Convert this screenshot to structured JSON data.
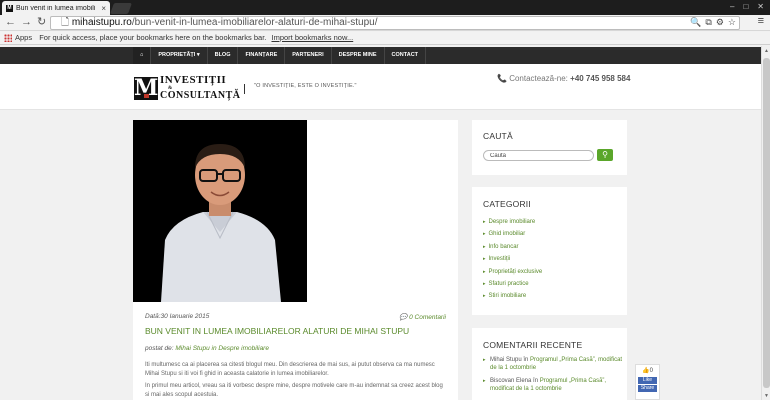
{
  "browser": {
    "tab_title": "Bun venit in lumea imobili",
    "url_host": "mihaistupu.ro",
    "url_path": "/bun-venit-in-lumea-imobiliarelor-alaturi-de-mihai-stupu/",
    "bookmarks_apps": "Apps",
    "bookmarks_text": "For quick access, place your bookmarks here on the bookmarks bar.",
    "bookmarks_import": "Import bookmarks now..."
  },
  "nav": {
    "items": [
      "PROPRIETĂȚI ▾",
      "BLOG",
      "FINANȚARE",
      "PARTENERI",
      "DESPRE MINE",
      "CONTACT"
    ]
  },
  "header": {
    "logo_line1": "INVESTIȚII",
    "logo_amp": "&",
    "logo_line2": "CONSULTANȚĂ",
    "tagline": "\"O INVESTIȚIE, ESTE O INVESTIȚIE.\"",
    "contact_label": "Contactează-ne:",
    "contact_phone": "+40 745 958 584"
  },
  "post": {
    "date_label": "Dată:",
    "date": "30 Ianuarie 2015",
    "comments": "0 Comentarii",
    "title": "BUN VENIT IN LUMEA IMOBILIARELOR ALATURI DE MIHAI STUPU",
    "byline_prefix": "postat de:",
    "author": "Mihai Stupu",
    "byline_in": "in",
    "category": "Despre imobiliare",
    "para1": "Iti multumesc ca ai placerea sa citesti blogul meu. Din descrierea de mai sus, ai putut observa ca ma numesc Mihai Stupu si iti voi fi ghid in aceasta calatorie in lumea imobiliarelor.",
    "para2": "In primul meu articol, vreau sa iti vorbesc despre mine, despre motivele care m-au indemnat sa creez acest blog si mai ales scopul acestuia."
  },
  "sidebar": {
    "search_title": "CAUTĂ",
    "search_value": "Cauta",
    "categories_title": "CATEGORII",
    "categories": [
      "Despre imobiliare",
      "Ghid imobiliar",
      "Info bancar",
      "Investiții",
      "Proprietăți exclusive",
      "Sfaturi practice",
      "Stiri imobiliare"
    ],
    "recent_title": "COMENTARII RECENTE",
    "recent": [
      {
        "author": "Mihai Stupu",
        "in": "în",
        "post": "Programul „Prima Casă”, modificat de la 1 octombrie"
      },
      {
        "author": "Biscovan Elena",
        "in": "în",
        "post": "Programul „Prima Casă”, modificat de la 1 octombrie"
      }
    ]
  },
  "social": {
    "count": "0",
    "like": "Like",
    "share": "Share"
  }
}
